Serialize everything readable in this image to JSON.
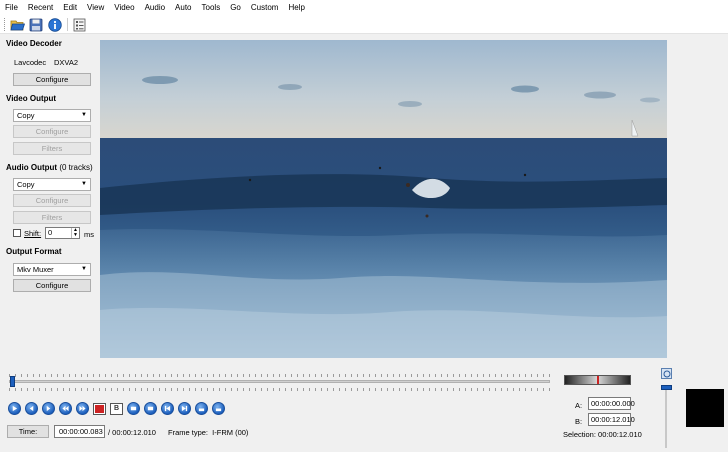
{
  "menu": [
    "File",
    "Recent",
    "Edit",
    "View",
    "Video",
    "Audio",
    "Auto",
    "Tools",
    "Go",
    "Custom",
    "Help"
  ],
  "toolbar": {
    "icons": [
      "open-folder-icon",
      "save-icon",
      "info-icon",
      "properties-icon"
    ]
  },
  "video_decoder": {
    "title": "Video Decoder",
    "decoder_name": "Lavcodec",
    "decoder_hw": "DXVA2",
    "configure_label": "Configure"
  },
  "video_output": {
    "title": "Video Output",
    "codec": "Copy",
    "configure_label": "Configure",
    "filters_label": "Filters"
  },
  "audio_output": {
    "title": "Audio Output",
    "tracks": "(0 tracks)",
    "codec": "Copy",
    "configure_label": "Configure",
    "filters_label": "Filters",
    "shift_label": "Shift:",
    "shift_value": "0",
    "shift_unit": "ms"
  },
  "output_format": {
    "title": "Output Format",
    "muxer": "Mkv Muxer",
    "configure_label": "Configure"
  },
  "status": {
    "time_button": "Time:",
    "current_time": "00:00:00.083",
    "total_time": "/ 00:00:12.010",
    "frame_type": "Frame type:  I-FRM (00)"
  },
  "selection": {
    "a_label": "A:",
    "a_value": "00:00:00.000",
    "b_label": "B:",
    "b_value": "00:00:12.010",
    "selection_text": "Selection: 00:00:12.010"
  },
  "playback_icons": [
    "play-icon",
    "previous-frame-icon",
    "next-frame-icon",
    "previous-keyframe-icon",
    "next-keyframe-icon",
    "set-marker-a-icon",
    "set-marker-b-icon",
    "previous-black-frame-icon",
    "next-black-frame-icon",
    "go-to-start-icon",
    "go-to-end-icon",
    "go-to-marker-a-icon",
    "go-to-marker-b-icon"
  ],
  "colors": {
    "accent": "#1c5fbd",
    "marker_a": "#cc2222",
    "preview_box": "#000000"
  }
}
